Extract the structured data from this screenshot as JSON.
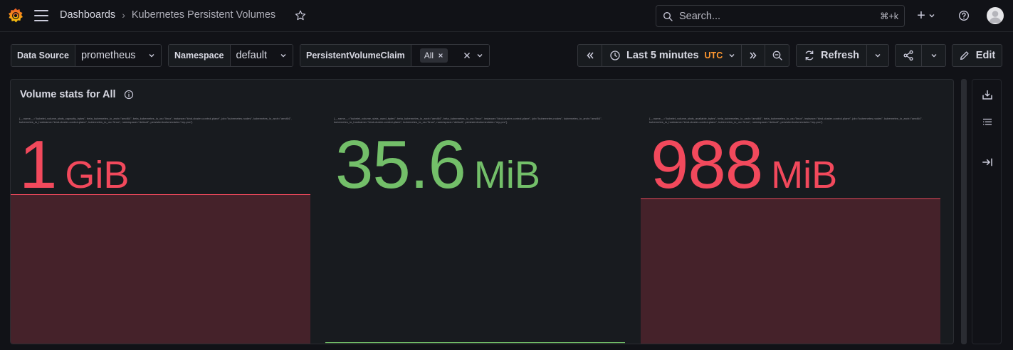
{
  "header": {
    "breadcrumb_root": "Dashboards",
    "breadcrumb_separator": "›",
    "breadcrumb_current": "Kubernetes Persistent Volumes",
    "search_placeholder": "Search...",
    "search_shortcut": "⌘+k",
    "add_label": "+"
  },
  "variables": [
    {
      "label": "Data Source",
      "value": "prometheus"
    },
    {
      "label": "Namespace",
      "value": "default"
    },
    {
      "label": "PersistentVolumeClaim",
      "value": "All"
    }
  ],
  "toolbar": {
    "time_range": "Last 5 minutes",
    "timezone": "UTC",
    "refresh_label": "Refresh",
    "edit_label": "Edit"
  },
  "panel": {
    "title": "Volume stats for All",
    "stats": [
      {
        "legend": "{__name__=\"kubelet_volume_stats_capacity_bytes\", beta_kubernetes_io_arch=\"amd64\", beta_kubernetes_io_os=\"linux\", instance=\"kind-cluster-control-plane\", job=\"kubernetes-nodes\", kubernetes_io_arch=\"amd64\", kubernetes_io_hostname=\"kind-cluster-control-plane\", kubernetes_io_os=\"linux\", namespace=\"default\", persistentvolumeclaim=\"my-pvc\"}",
        "value": "1",
        "unit": "GiB",
        "color": "#f2495c",
        "fill_color": "#45222a",
        "fill_level": 0.75
      },
      {
        "legend": "{__name__=\"kubelet_volume_stats_used_bytes\", beta_kubernetes_io_arch=\"amd64\", beta_kubernetes_io_os=\"linux\", instance=\"kind-cluster-control-plane\", job=\"kubernetes-nodes\", kubernetes_io_arch=\"amd64\", kubernetes_io_hostname=\"kind-cluster-control-plane\", kubernetes_io_os=\"linux\", namespace=\"default\", persistentvolumeclaim=\"my-pvc\"}",
        "value": "35.6",
        "unit": "MiB",
        "color": "#73bf69",
        "fill_color": "#2a3a2a",
        "fill_level": 0.0
      },
      {
        "legend": "{__name__=\"kubelet_volume_stats_available_bytes\", beta_kubernetes_io_arch=\"amd64\", beta_kubernetes_io_os=\"linux\", instance=\"kind-cluster-control-plane\", job=\"kubernetes-nodes\", kubernetes_io_arch=\"amd64\", kubernetes_io_hostname=\"kind-cluster-control-plane\", kubernetes_io_os=\"linux\", namespace=\"default\", persistentvolumeclaim=\"my-pvc\"}",
        "value": "988",
        "unit": "MiB",
        "color": "#f2495c",
        "fill_color": "#45222a",
        "fill_level": 0.73
      }
    ]
  },
  "colors": {
    "accent_orange": "#ff9830",
    "background": "#111217",
    "panel_bg": "#181b1f"
  },
  "icons": {
    "logo": "grafana-logo",
    "menu": "hamburger-icon",
    "star": "star-icon",
    "search": "search-icon",
    "help": "help-circle-icon",
    "user": "user-avatar-icon",
    "time": "clock-icon",
    "zoom": "zoom-out-icon",
    "refresh": "sync-icon",
    "share": "share-icon",
    "edit": "pencil-icon",
    "info": "info-circle-icon",
    "import": "download-icon",
    "outline": "list-icon",
    "collapse": "arrow-to-right-icon"
  }
}
